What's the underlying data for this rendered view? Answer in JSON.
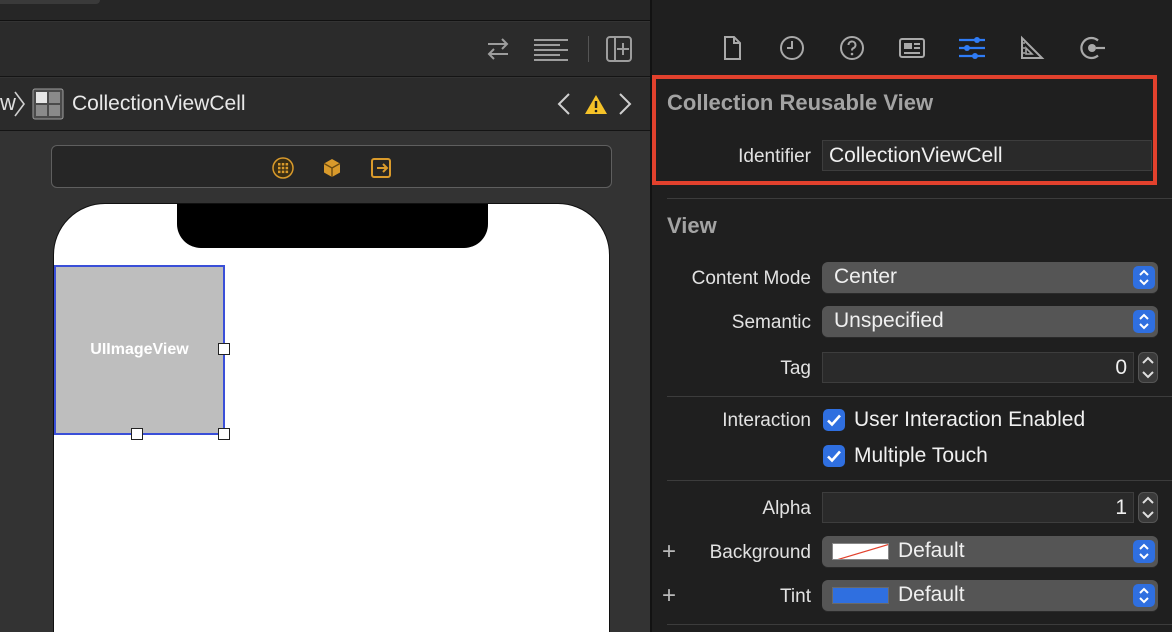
{
  "editor": {
    "jumpbar": {
      "prev_fragment": "w",
      "current": "CollectionViewCell"
    },
    "canvas": {
      "image_view_label": "UIImageView"
    }
  },
  "inspector": {
    "tabs": [
      {
        "name": "file-inspector",
        "icon": "document-icon"
      },
      {
        "name": "history-inspector",
        "icon": "clock-icon"
      },
      {
        "name": "quick-help-inspector",
        "icon": "help-icon"
      },
      {
        "name": "identity-inspector",
        "icon": "id-card-icon"
      },
      {
        "name": "attributes-inspector",
        "icon": "sliders-icon",
        "active": true
      },
      {
        "name": "size-inspector",
        "icon": "ruler-icon"
      },
      {
        "name": "connections-inspector",
        "icon": "connection-icon"
      }
    ],
    "reusable": {
      "title": "Collection Reusable View",
      "identifier_label": "Identifier",
      "identifier_value": "CollectionViewCell"
    },
    "view": {
      "title": "View",
      "content_mode_label": "Content Mode",
      "content_mode_value": "Center",
      "semantic_label": "Semantic",
      "semantic_value": "Unspecified",
      "tag_label": "Tag",
      "tag_value": "0",
      "interaction_label": "Interaction",
      "user_interaction_label": "User Interaction Enabled",
      "user_interaction_checked": true,
      "multiple_touch_label": "Multiple Touch",
      "multiple_touch_checked": true,
      "alpha_label": "Alpha",
      "alpha_value": "1",
      "plus_symbol": "+",
      "background_label": "Background",
      "background_value": "Default",
      "tint_label": "Tint",
      "tint_value": "Default"
    }
  },
  "colors": {
    "accent": "#2f6fe0",
    "highlight": "#e2412d",
    "selection": "#3a4fd8",
    "warning": "#f5c228",
    "scene_icon": "#d99a2b"
  }
}
